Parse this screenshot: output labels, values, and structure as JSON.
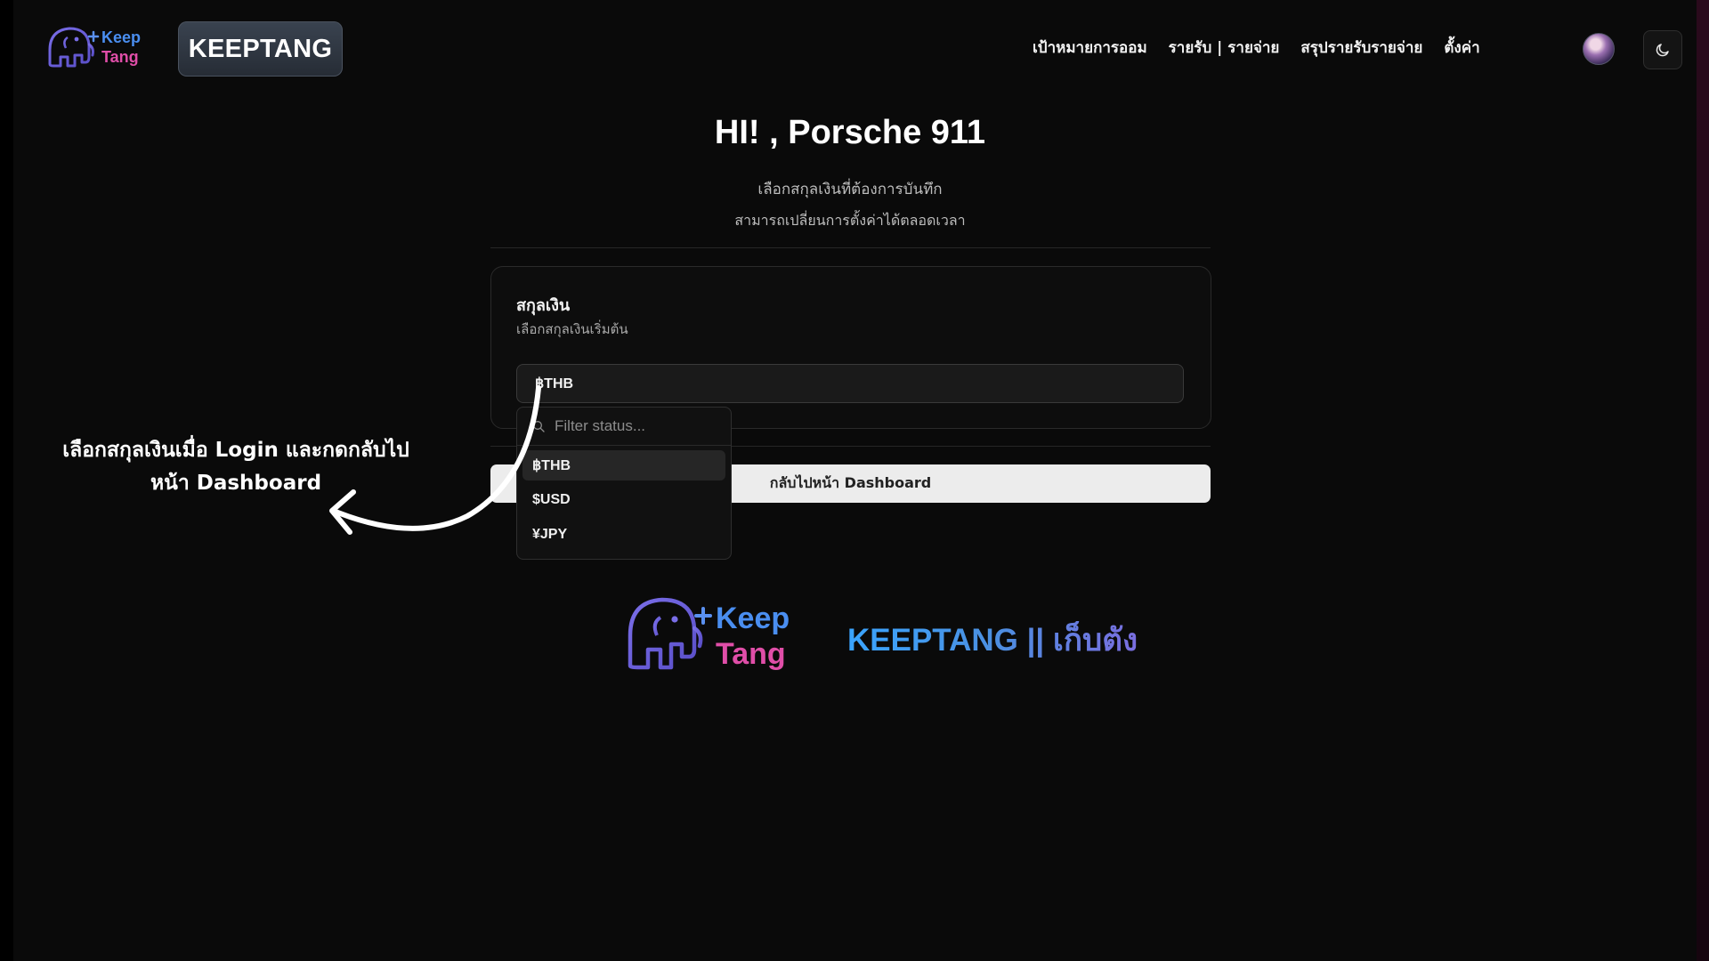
{
  "brand": {
    "logo_word1": "Keep",
    "logo_word2": "Tang",
    "name": "KEEPTANG",
    "footer_text": "KEEPTANG || เก็บตัง",
    "colors": {
      "keep": "#4a8ef0",
      "tang": "#e04ea8",
      "outline": "#6b5fd6"
    }
  },
  "nav": {
    "items": [
      {
        "label": "เป้าหมายการออม"
      },
      {
        "label": "รายรับ | รายจ่าย"
      },
      {
        "label": "สรุปรายรับรายจ่าย"
      },
      {
        "label": "ตั้งค่า"
      }
    ],
    "theme_icon": "moon-icon"
  },
  "main": {
    "greeting": "HI! , Porsche 911",
    "subtitle": "เลือกสกุลเงินที่ต้องการบันทึก",
    "subtitle2": "สามารถเปลี่ยนการตั้งค่าได้ตลอดเวลา",
    "card": {
      "title": "สกุลเงิน",
      "description": "เลือกสกุลเงินเริ่มต้น",
      "selected_value": "฿THB"
    },
    "back_button": "กลับไปหน้า Dashboard"
  },
  "dropdown": {
    "search_placeholder": "Filter status...",
    "options": [
      {
        "label": "฿THB",
        "active": true
      },
      {
        "label": "$USD",
        "active": false
      },
      {
        "label": "¥JPY",
        "active": false
      }
    ]
  },
  "annotation": {
    "line1": "เลือกสกุลเงินเมื่อ Login และกดกลับไป",
    "line2": "หน้า Dashboard"
  }
}
